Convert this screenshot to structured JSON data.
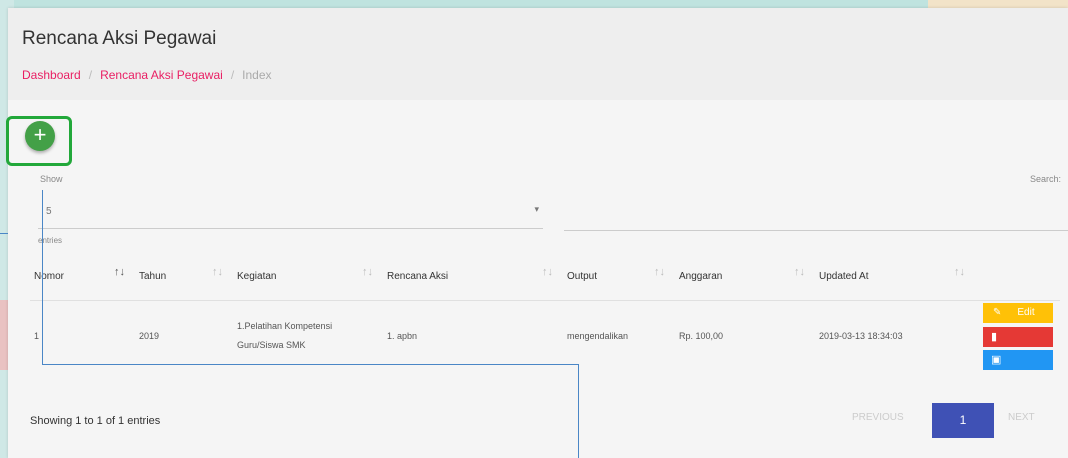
{
  "header": {
    "title": "Rencana Aksi Pegawai",
    "breadcrumb": [
      "Dashboard",
      "Rencana Aksi Pegawai",
      "Index"
    ]
  },
  "toolbar": {
    "add_label": "+"
  },
  "table_controls": {
    "show_label": "Show",
    "show_value": "5",
    "entries_label": "entries",
    "search_label": "Search:"
  },
  "table": {
    "columns": [
      "Nomor",
      "Tahun",
      "Kegiatan",
      "Rencana Aksi",
      "Output",
      "Anggaran",
      "Updated At"
    ],
    "rows": [
      {
        "nomor": "1",
        "tahun": "2019",
        "kegiatan": "1.Pelatihan Kompetensi Guru/Siswa SMK",
        "rencana_aksi": "1. apbn",
        "output": "mengendalikan",
        "anggaran": "Rp. 100,00",
        "updated_at": "2019-03-13 18:34:03"
      }
    ]
  },
  "actions": {
    "edit_label": "Edit"
  },
  "footer": {
    "info": "Showing 1 to 1 of 1 entries",
    "previous": "PREVIOUS",
    "current_page": "1",
    "next": "NEXT"
  },
  "colors": {
    "accent_pink": "#e91e63",
    "add_green": "#43a047",
    "edit_yellow": "#ffc107",
    "delete_red": "#e53935",
    "view_blue": "#2196f3",
    "page_indigo": "#3f51b5",
    "highlight_green": "#22a83a"
  }
}
